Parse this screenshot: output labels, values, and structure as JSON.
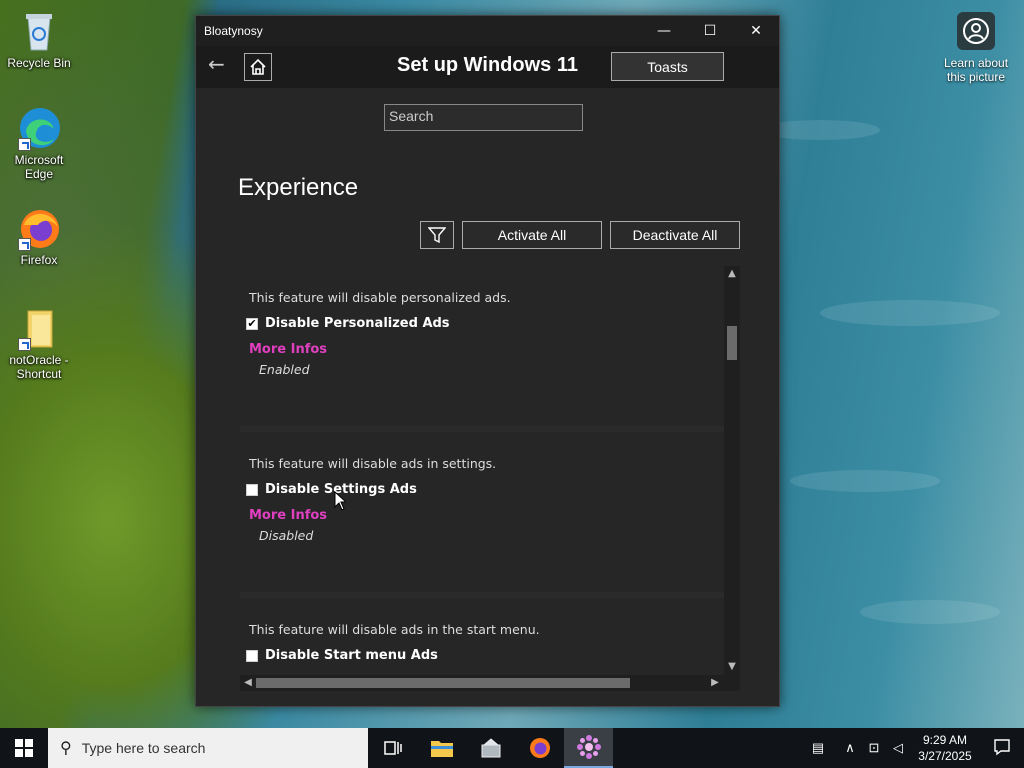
{
  "desktop": {
    "icons": [
      {
        "label": "Recycle Bin",
        "icon": "recycle-bin-icon"
      },
      {
        "label": "Microsoft Edge",
        "icon": "edge-icon"
      },
      {
        "label": "Firefox",
        "icon": "firefox-icon"
      },
      {
        "label": "notOracle - Shortcut",
        "icon": "folder-icon"
      }
    ],
    "learn": "Learn about this picture"
  },
  "window": {
    "title": "Bloatynosy",
    "controls": {
      "minimize": "—",
      "maximize": "☐",
      "close": "✕"
    },
    "header": {
      "back": "←",
      "title": "Set up Windows 11",
      "toasts_label": "Toasts"
    },
    "search_placeholder": "Search",
    "section_title": "Experience",
    "activate_all": "Activate All",
    "deactivate_all": "Deactivate All",
    "features": [
      {
        "description": "This feature will disable personalized ads.",
        "name": "Disable Personalized Ads",
        "checked": true,
        "more": "More Infos",
        "status": "Enabled"
      },
      {
        "description": "This feature will disable ads in settings.",
        "name": "Disable Settings Ads",
        "checked": false,
        "more": "More Infos",
        "status": "Disabled"
      },
      {
        "description": "This feature will disable ads in the start menu.",
        "name": "Disable Start menu Ads",
        "checked": false,
        "more": "",
        "status": ""
      }
    ]
  },
  "taskbar": {
    "search_placeholder": "Type here to search",
    "time": "9:29 AM",
    "date": "3/27/2025"
  },
  "colors": {
    "accent_link": "#e040c0",
    "window_bg": "#262626"
  }
}
